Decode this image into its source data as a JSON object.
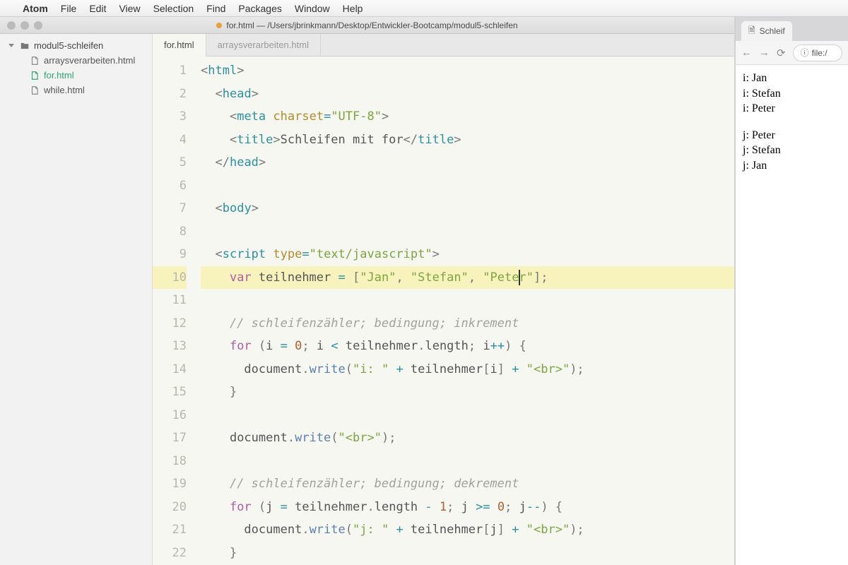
{
  "menubar": {
    "apple": "",
    "app": "Atom",
    "items": [
      "File",
      "Edit",
      "View",
      "Selection",
      "Find",
      "Packages",
      "Window",
      "Help"
    ]
  },
  "window": {
    "title": "for.html — /Users/jbrinkmann/Desktop/Entwickler-Bootcamp/modul5-schleifen"
  },
  "tree": {
    "root": "modul5-schleifen",
    "files": [
      {
        "name": "arraysverarbeiten.html",
        "active": false
      },
      {
        "name": "for.html",
        "active": true
      },
      {
        "name": "while.html",
        "active": false
      }
    ]
  },
  "tabs": [
    {
      "label": "for.html",
      "active": true
    },
    {
      "label": "arraysverarbeiten.html",
      "active": false
    }
  ],
  "code": {
    "highlighted_line": 10,
    "lines": [
      {
        "n": 1,
        "tokens": [
          [
            "p",
            "<"
          ],
          [
            "tg",
            "html"
          ],
          [
            "p",
            ">"
          ]
        ]
      },
      {
        "n": 2,
        "indent": 1,
        "tokens": [
          [
            "p",
            "<"
          ],
          [
            "tg",
            "head"
          ],
          [
            "p",
            ">"
          ]
        ]
      },
      {
        "n": 3,
        "indent": 2,
        "tokens": [
          [
            "p",
            "<"
          ],
          [
            "tg",
            "meta"
          ],
          [
            "id",
            " "
          ],
          [
            "at",
            "charset"
          ],
          [
            "op",
            "="
          ],
          [
            "st",
            "\"UTF-8\""
          ],
          [
            "p",
            ">"
          ]
        ]
      },
      {
        "n": 4,
        "indent": 2,
        "tokens": [
          [
            "p",
            "<"
          ],
          [
            "tg",
            "title"
          ],
          [
            "p",
            ">"
          ],
          [
            "id",
            "Schleifen mit for"
          ],
          [
            "p",
            "</"
          ],
          [
            "tg",
            "title"
          ],
          [
            "p",
            ">"
          ]
        ]
      },
      {
        "n": 5,
        "indent": 1,
        "tokens": [
          [
            "p",
            "</"
          ],
          [
            "tg",
            "head"
          ],
          [
            "p",
            ">"
          ]
        ]
      },
      {
        "n": 6,
        "tokens": []
      },
      {
        "n": 7,
        "indent": 1,
        "tokens": [
          [
            "p",
            "<"
          ],
          [
            "tg",
            "body"
          ],
          [
            "p",
            ">"
          ]
        ]
      },
      {
        "n": 8,
        "tokens": []
      },
      {
        "n": 9,
        "indent": 1,
        "tokens": [
          [
            "p",
            "<"
          ],
          [
            "tg",
            "script"
          ],
          [
            "id",
            " "
          ],
          [
            "at",
            "type"
          ],
          [
            "op",
            "="
          ],
          [
            "st",
            "\"text/javascript\""
          ],
          [
            "p",
            ">"
          ]
        ]
      },
      {
        "n": 10,
        "indent": 2,
        "tokens": [
          [
            "kw",
            "var"
          ],
          [
            "id",
            " teilnehmer "
          ],
          [
            "op",
            "="
          ],
          [
            "id",
            " "
          ],
          [
            "p",
            "["
          ],
          [
            "st",
            "\"Jan\""
          ],
          [
            "p",
            ", "
          ],
          [
            "st",
            "\"Stefan\""
          ],
          [
            "p",
            ", "
          ],
          [
            "st",
            "\"Peter\""
          ],
          [
            "p",
            "];"
          ]
        ]
      },
      {
        "n": 11,
        "tokens": []
      },
      {
        "n": 12,
        "indent": 2,
        "tokens": [
          [
            "cm",
            "// schleifenzähler; bedingung; inkrement"
          ]
        ]
      },
      {
        "n": 13,
        "indent": 2,
        "tokens": [
          [
            "kw",
            "for"
          ],
          [
            "id",
            " "
          ],
          [
            "p",
            "("
          ],
          [
            "id",
            "i "
          ],
          [
            "op",
            "="
          ],
          [
            "id",
            " "
          ],
          [
            "nu",
            "0"
          ],
          [
            "p",
            "; "
          ],
          [
            "id",
            "i "
          ],
          [
            "op",
            "<"
          ],
          [
            "id",
            " teilnehmer"
          ],
          [
            "p",
            "."
          ],
          [
            "id",
            "length"
          ],
          [
            "p",
            "; "
          ],
          [
            "id",
            "i"
          ],
          [
            "op",
            "++"
          ],
          [
            "p",
            ") {"
          ]
        ]
      },
      {
        "n": 14,
        "indent": 3,
        "tokens": [
          [
            "id",
            "document"
          ],
          [
            "p",
            "."
          ],
          [
            "fn",
            "write"
          ],
          [
            "p",
            "("
          ],
          [
            "st",
            "\"i: \""
          ],
          [
            "id",
            " "
          ],
          [
            "op",
            "+"
          ],
          [
            "id",
            " teilnehmer"
          ],
          [
            "p",
            "["
          ],
          [
            "id",
            "i"
          ],
          [
            "p",
            "] "
          ],
          [
            "op",
            "+"
          ],
          [
            "id",
            " "
          ],
          [
            "st",
            "\"<br>\""
          ],
          [
            "p",
            ");"
          ]
        ]
      },
      {
        "n": 15,
        "indent": 2,
        "tokens": [
          [
            "p",
            "}"
          ]
        ]
      },
      {
        "n": 16,
        "tokens": []
      },
      {
        "n": 17,
        "indent": 2,
        "tokens": [
          [
            "id",
            "document"
          ],
          [
            "p",
            "."
          ],
          [
            "fn",
            "write"
          ],
          [
            "p",
            "("
          ],
          [
            "st",
            "\"<br>\""
          ],
          [
            "p",
            ");"
          ]
        ]
      },
      {
        "n": 18,
        "tokens": []
      },
      {
        "n": 19,
        "indent": 2,
        "tokens": [
          [
            "cm",
            "// schleifenzähler; bedingung; dekrement"
          ]
        ]
      },
      {
        "n": 20,
        "indent": 2,
        "tokens": [
          [
            "kw",
            "for"
          ],
          [
            "id",
            " "
          ],
          [
            "p",
            "("
          ],
          [
            "id",
            "j "
          ],
          [
            "op",
            "="
          ],
          [
            "id",
            " teilnehmer"
          ],
          [
            "p",
            "."
          ],
          [
            "id",
            "length "
          ],
          [
            "op",
            "-"
          ],
          [
            "id",
            " "
          ],
          [
            "nu",
            "1"
          ],
          [
            "p",
            "; "
          ],
          [
            "id",
            "j "
          ],
          [
            "op",
            ">="
          ],
          [
            "id",
            " "
          ],
          [
            "nu",
            "0"
          ],
          [
            "p",
            "; "
          ],
          [
            "id",
            "j"
          ],
          [
            "op",
            "--"
          ],
          [
            "p",
            ") {"
          ]
        ]
      },
      {
        "n": 21,
        "indent": 3,
        "tokens": [
          [
            "id",
            "document"
          ],
          [
            "p",
            "."
          ],
          [
            "fn",
            "write"
          ],
          [
            "p",
            "("
          ],
          [
            "st",
            "\"j: \""
          ],
          [
            "id",
            " "
          ],
          [
            "op",
            "+"
          ],
          [
            "id",
            " teilnehmer"
          ],
          [
            "p",
            "["
          ],
          [
            "id",
            "j"
          ],
          [
            "p",
            "] "
          ],
          [
            "op",
            "+"
          ],
          [
            "id",
            " "
          ],
          [
            "st",
            "\"<br>\""
          ],
          [
            "p",
            ");"
          ]
        ]
      },
      {
        "n": 22,
        "indent": 2,
        "tokens": [
          [
            "p",
            "}"
          ]
        ]
      }
    ]
  },
  "browser": {
    "tab_title": "Schleif",
    "url_label": "file:/",
    "info_icon": "ⓘ",
    "output": [
      "i: Jan",
      "i: Stefan",
      "i: Peter",
      "",
      "j: Peter",
      "j: Stefan",
      "j: Jan"
    ]
  }
}
